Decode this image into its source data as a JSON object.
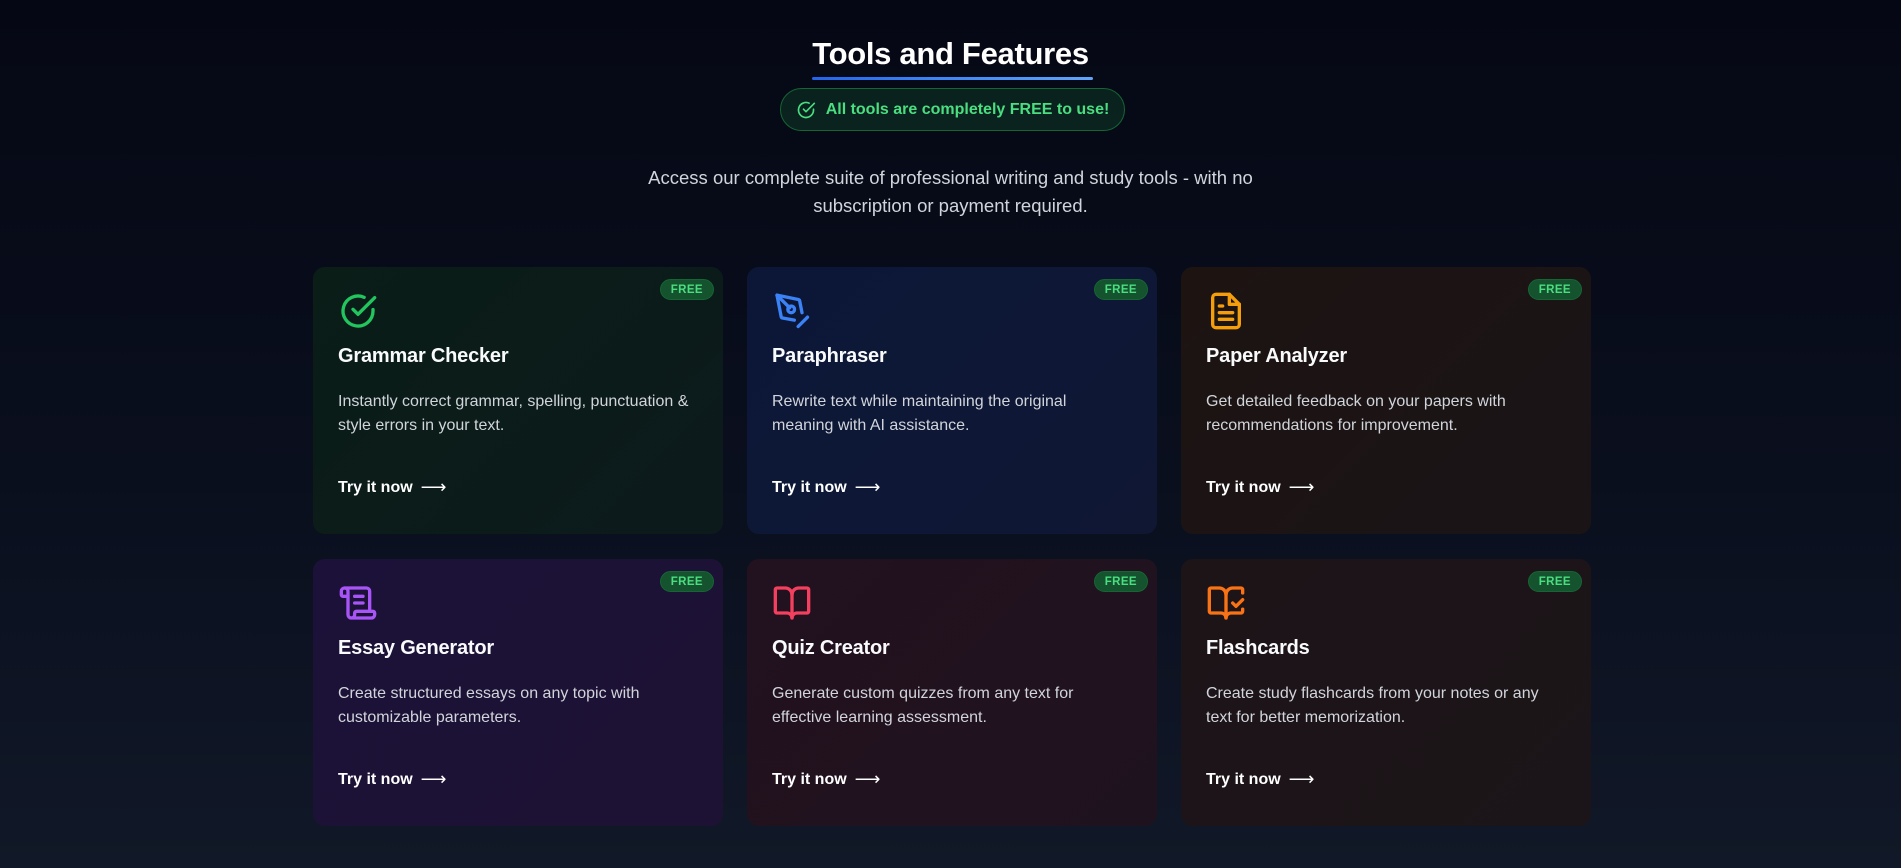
{
  "section": {
    "title": "Tools and Features",
    "free_banner": "All tools are completely FREE to use!",
    "subtitle": "Access our complete suite of professional writing and study tools - with no subscription or payment required."
  },
  "colors": {
    "accent_green": "#4ade80",
    "accent_blue": "#3b82f6"
  },
  "tools": [
    {
      "title": "Grammar Checker",
      "description": "Instantly correct grammar, spelling, punctuation & style errors in your text.",
      "badge": "FREE",
      "cta": "Try it now",
      "icon": "check-circle-icon",
      "icon_color": "#22c55e"
    },
    {
      "title": "Paraphraser",
      "description": "Rewrite text while maintaining the original meaning with AI assistance.",
      "badge": "FREE",
      "cta": "Try it now",
      "icon": "pen-nib-icon",
      "icon_color": "#3b82f6"
    },
    {
      "title": "Paper Analyzer",
      "description": "Get detailed feedback on your papers with recommendations for improvement.",
      "badge": "FREE",
      "cta": "Try it now",
      "icon": "document-icon",
      "icon_color": "#f59e0b"
    },
    {
      "title": "Essay Generator",
      "description": "Create structured essays on any topic with customizable parameters.",
      "badge": "FREE",
      "cta": "Try it now",
      "icon": "scroll-icon",
      "icon_color": "#a855f7"
    },
    {
      "title": "Quiz Creator",
      "description": "Generate custom quizzes from any text for effective learning assessment.",
      "badge": "FREE",
      "cta": "Try it now",
      "icon": "open-book-icon",
      "icon_color": "#f43f5e"
    },
    {
      "title": "Flashcards",
      "description": "Create study flashcards from your notes or any text for better memorization.",
      "badge": "FREE",
      "cta": "Try it now",
      "icon": "book-check-icon",
      "icon_color": "#f97316"
    }
  ]
}
